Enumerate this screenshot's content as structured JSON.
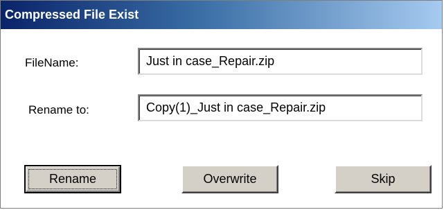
{
  "dialog": {
    "title": "Compressed File Exist",
    "filename_label": "FileName:",
    "filename_value": "Just in case_Repair.zip",
    "rename_label": "Rename to:",
    "rename_value": "Copy(1)_Just in case_Repair.zip",
    "buttons": {
      "rename": "Rename",
      "overwrite": "Overwrite",
      "skip": "Skip"
    }
  },
  "colors": {
    "titlebar_start": "#0a246a",
    "titlebar_end": "#a6caf0",
    "button_face": "#d4d0c8"
  }
}
